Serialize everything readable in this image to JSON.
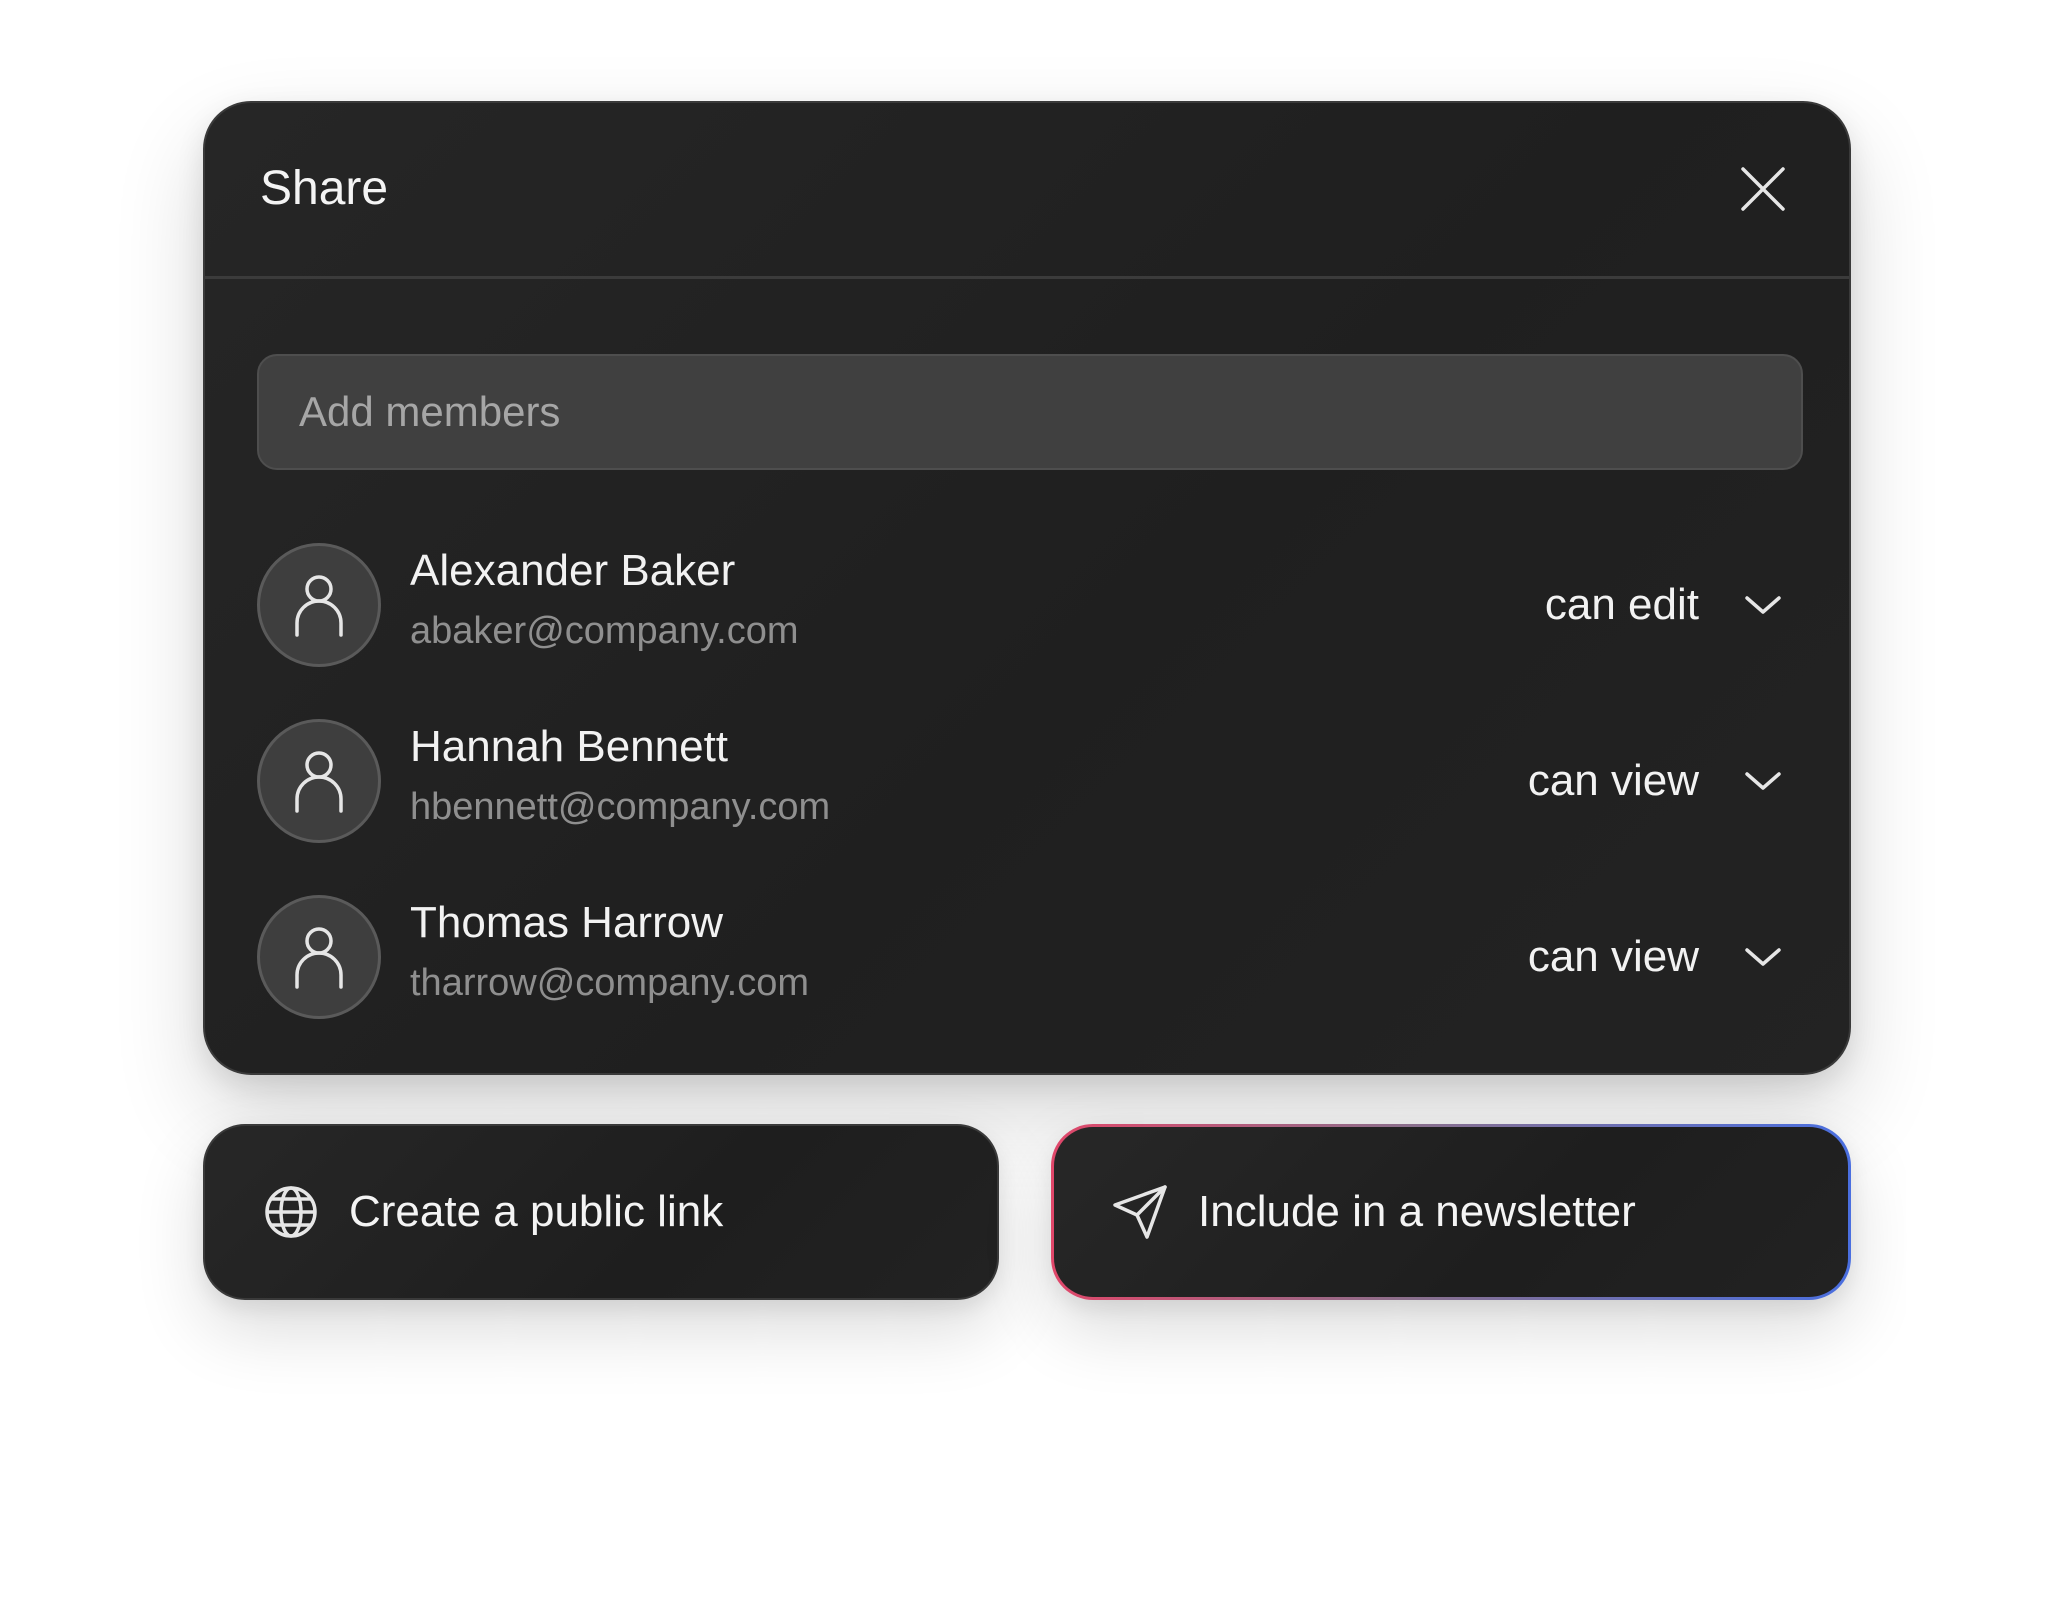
{
  "dialog": {
    "title": "Share",
    "close_icon": "close-icon"
  },
  "search": {
    "placeholder": "Add members",
    "value": ""
  },
  "members": [
    {
      "name": "Alexander Baker",
      "email": "abaker@company.com",
      "permission": "can edit",
      "avatar_icon": "user-icon",
      "dropdown_icon": "chevron-down-icon"
    },
    {
      "name": "Hannah Bennett",
      "email": "hbennett@company.com",
      "permission": "can view",
      "avatar_icon": "user-icon",
      "dropdown_icon": "chevron-down-icon"
    },
    {
      "name": "Thomas Harrow",
      "email": "tharrow@company.com",
      "permission": "can view",
      "avatar_icon": "user-icon",
      "dropdown_icon": "chevron-down-icon"
    }
  ],
  "actions": {
    "public_link": {
      "label": "Create a public link",
      "icon": "globe-icon"
    },
    "newsletter": {
      "label": "Include in a newsletter",
      "icon": "send-icon"
    }
  },
  "colors": {
    "panel_background": "#222222",
    "newsletter_border_start": "#e0476a",
    "newsletter_border_end": "#4a6fe0",
    "secondary_text": "#8f8f8f"
  }
}
